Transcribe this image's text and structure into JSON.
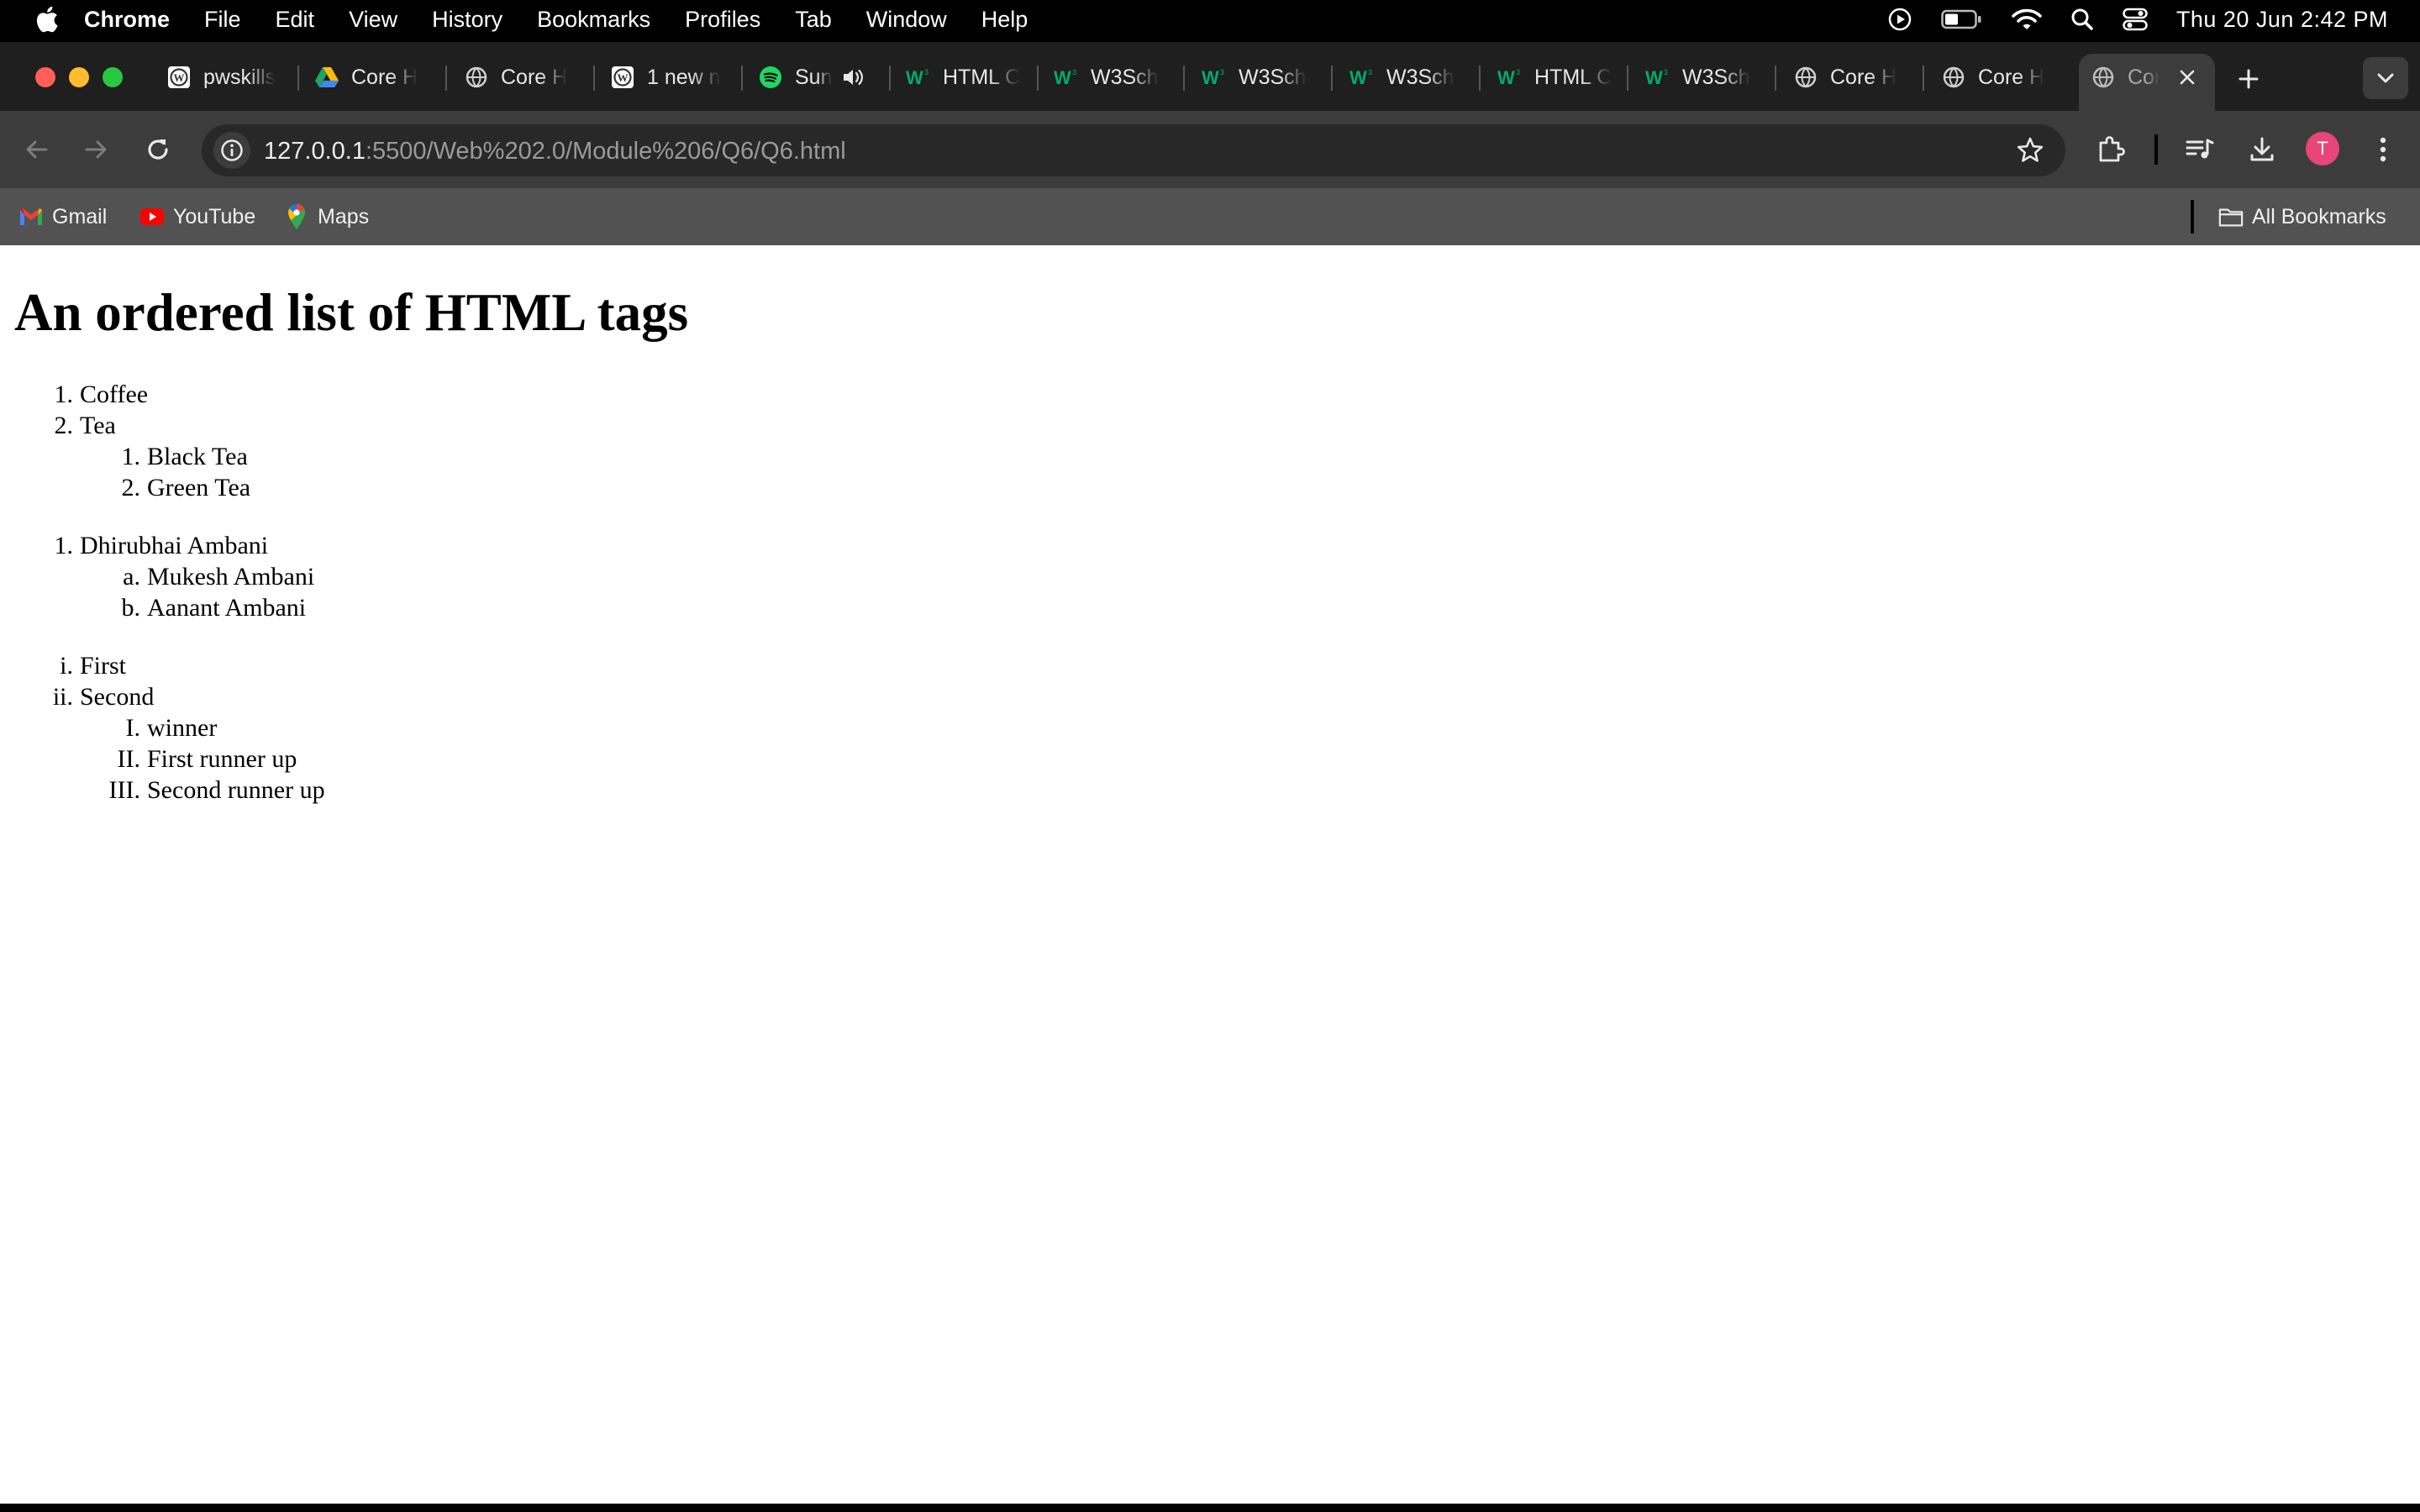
{
  "menubar": {
    "items": [
      "Chrome",
      "File",
      "Edit",
      "View",
      "History",
      "Bookmarks",
      "Profiles",
      "Tab",
      "Window",
      "Help"
    ],
    "clock": "Thu 20 Jun  2:42 PM"
  },
  "tabs": [
    {
      "label": "pwskills",
      "icon": "wordpress-icon"
    },
    {
      "label": "Core H",
      "icon": "drive-icon"
    },
    {
      "label": "Core H",
      "icon": "globe-icon"
    },
    {
      "label": "1 new n",
      "icon": "wordpress-icon"
    },
    {
      "label": "Sun",
      "icon": "spotify-icon"
    },
    {
      "label": "HTML C",
      "icon": "w3schools-icon"
    },
    {
      "label": "W3Sch",
      "icon": "w3schools-icon"
    },
    {
      "label": "W3Sch",
      "icon": "w3schools-icon"
    },
    {
      "label": "W3Sch",
      "icon": "w3schools-icon"
    },
    {
      "label": "HTML C",
      "icon": "w3schools-icon"
    },
    {
      "label": "W3Sch",
      "icon": "w3schools-icon"
    },
    {
      "label": "Core H",
      "icon": "globe-icon"
    },
    {
      "label": "Core H",
      "icon": "globe-icon"
    },
    {
      "label": "Cor",
      "icon": "globe-icon"
    }
  ],
  "address_bar": {
    "host": "127.0.0.1",
    "path": ":5500/Web%202.0/Module%206/Q6/Q6.html"
  },
  "profile_initial": "T",
  "bookmarks": {
    "items": [
      "Gmail",
      "YouTube",
      "Maps"
    ],
    "all_bookmarks": "All Bookmarks"
  },
  "page": {
    "heading": "An ordered list of HTML tags",
    "list1": {
      "items": [
        {
          "marker": "1.",
          "text": "Coffee"
        },
        {
          "marker": "2.",
          "text": "Tea"
        }
      ],
      "nested": [
        {
          "marker": "1.",
          "text": "Black Tea"
        },
        {
          "marker": "2.",
          "text": "Green Tea"
        }
      ]
    },
    "list2": {
      "items": [
        {
          "marker": "1.",
          "text": "Dhirubhai Ambani"
        }
      ],
      "nested": [
        {
          "marker": "a.",
          "text": "Mukesh Ambani"
        },
        {
          "marker": "b.",
          "text": "Aanant Ambani"
        }
      ]
    },
    "list3": {
      "items": [
        {
          "marker": "i.",
          "text": "First"
        },
        {
          "marker": "ii.",
          "text": "Second"
        }
      ],
      "nested": [
        {
          "marker": "I.",
          "text": "winner"
        },
        {
          "marker": "II.",
          "text": "First runner up"
        },
        {
          "marker": "III.",
          "text": "Second runner up"
        }
      ]
    }
  }
}
